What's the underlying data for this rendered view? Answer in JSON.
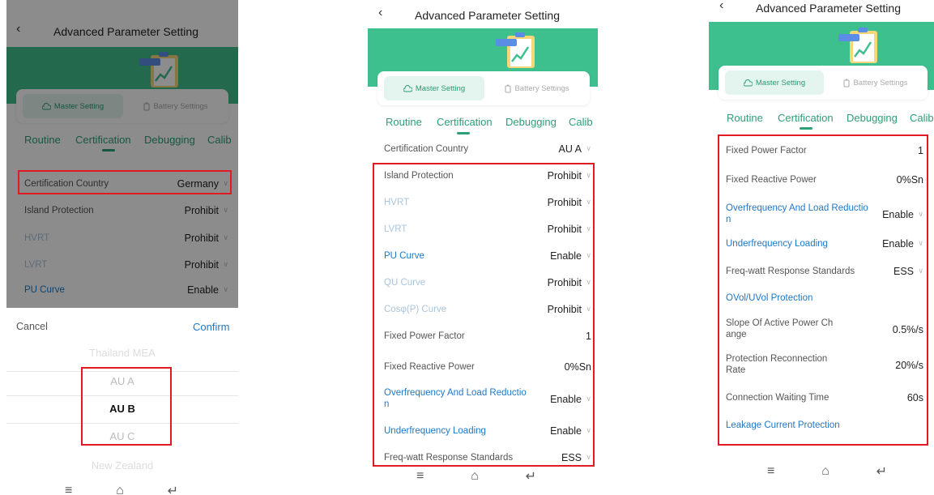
{
  "header": {
    "title": "Advanced Parameter Setting",
    "back_icon": "chevron-left-icon"
  },
  "toggle": {
    "master": "Master Setting",
    "battery": "Battery Settings"
  },
  "tabs": [
    "Routine",
    "Certification",
    "Debugging",
    "Calib"
  ],
  "colors": {
    "accent": "#3ebf8e",
    "tab": "#2d9e75",
    "link": "#1e78c8",
    "highlight": "#e01b24"
  },
  "screen1": {
    "rows": [
      {
        "label": "Certification Country",
        "value": "Germany"
      },
      {
        "label": "Island Protection",
        "value": "Prohibit"
      },
      {
        "label": "HVRT",
        "value": "Prohibit"
      },
      {
        "label": "LVRT",
        "value": "Prohibit"
      },
      {
        "label": "PU Curve",
        "value": "Enable"
      }
    ],
    "picker": {
      "cancel": "Cancel",
      "confirm": "Confirm",
      "options": [
        "Thailand MEA",
        "AU A",
        "AU B",
        "AU C",
        "New Zealand"
      ]
    }
  },
  "screen2": {
    "rows": [
      {
        "label": "Certification Country",
        "value": "AU A"
      },
      {
        "label": "Island Protection",
        "value": "Prohibit"
      },
      {
        "label": "HVRT",
        "value": "Prohibit"
      },
      {
        "label": "LVRT",
        "value": "Prohibit"
      },
      {
        "label": "PU Curve",
        "value": "Enable"
      },
      {
        "label": "QU Curve",
        "value": "Prohibit"
      },
      {
        "label": "Cosφ(P) Curve",
        "value": "Prohibit"
      },
      {
        "label": "Fixed Power Factor",
        "value": "1"
      },
      {
        "label": "Fixed Reactive Power",
        "value": "0%Sn"
      },
      {
        "label": "Overfrequency And Load Reductio\nn",
        "value": "Enable"
      },
      {
        "label": "Underfrequency Loading",
        "value": "Enable"
      },
      {
        "label": "Freq-watt Response Standards",
        "value": "ESS"
      }
    ]
  },
  "screen3": {
    "rows": [
      {
        "label": "Fixed Power Factor",
        "value": "1"
      },
      {
        "label": "Fixed Reactive Power",
        "value": "0%Sn"
      },
      {
        "label": "Overfrequency And Load Reductio\nn",
        "value": "Enable"
      },
      {
        "label": "Underfrequency Loading",
        "value": "Enable"
      },
      {
        "label": "Freq-watt Response Standards",
        "value": "ESS"
      },
      {
        "label": "OVol/UVol Protection",
        "value": ""
      },
      {
        "label": "Slope Of Active Power Ch\nange",
        "value": "0.5%/s"
      },
      {
        "label": "Protection Reconnection\nRate",
        "value": "20%/s"
      },
      {
        "label": "Connection Waiting Time",
        "value": "60s"
      },
      {
        "label": "Leakage Current Protection",
        "value": ""
      }
    ]
  }
}
